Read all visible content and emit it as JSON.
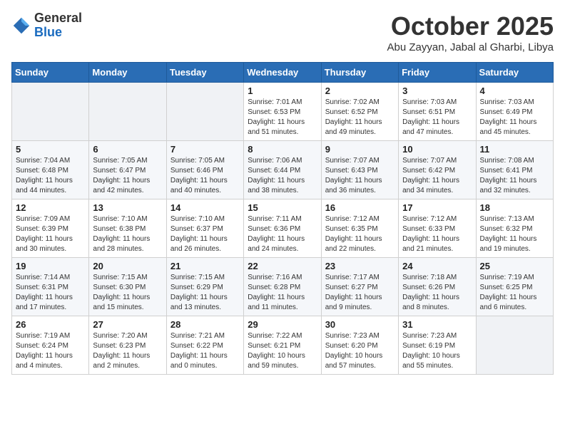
{
  "logo": {
    "general": "General",
    "blue": "Blue"
  },
  "header": {
    "month": "October 2025",
    "location": "Abu Zayyan, Jabal al Gharbi, Libya"
  },
  "weekdays": [
    "Sunday",
    "Monday",
    "Tuesday",
    "Wednesday",
    "Thursday",
    "Friday",
    "Saturday"
  ],
  "weeks": [
    [
      {
        "day": "",
        "sunrise": "",
        "sunset": "",
        "daylight": ""
      },
      {
        "day": "",
        "sunrise": "",
        "sunset": "",
        "daylight": ""
      },
      {
        "day": "",
        "sunrise": "",
        "sunset": "",
        "daylight": ""
      },
      {
        "day": "1",
        "sunrise": "Sunrise: 7:01 AM",
        "sunset": "Sunset: 6:53 PM",
        "daylight": "Daylight: 11 hours and 51 minutes."
      },
      {
        "day": "2",
        "sunrise": "Sunrise: 7:02 AM",
        "sunset": "Sunset: 6:52 PM",
        "daylight": "Daylight: 11 hours and 49 minutes."
      },
      {
        "day": "3",
        "sunrise": "Sunrise: 7:03 AM",
        "sunset": "Sunset: 6:51 PM",
        "daylight": "Daylight: 11 hours and 47 minutes."
      },
      {
        "day": "4",
        "sunrise": "Sunrise: 7:03 AM",
        "sunset": "Sunset: 6:49 PM",
        "daylight": "Daylight: 11 hours and 45 minutes."
      }
    ],
    [
      {
        "day": "5",
        "sunrise": "Sunrise: 7:04 AM",
        "sunset": "Sunset: 6:48 PM",
        "daylight": "Daylight: 11 hours and 44 minutes."
      },
      {
        "day": "6",
        "sunrise": "Sunrise: 7:05 AM",
        "sunset": "Sunset: 6:47 PM",
        "daylight": "Daylight: 11 hours and 42 minutes."
      },
      {
        "day": "7",
        "sunrise": "Sunrise: 7:05 AM",
        "sunset": "Sunset: 6:46 PM",
        "daylight": "Daylight: 11 hours and 40 minutes."
      },
      {
        "day": "8",
        "sunrise": "Sunrise: 7:06 AM",
        "sunset": "Sunset: 6:44 PM",
        "daylight": "Daylight: 11 hours and 38 minutes."
      },
      {
        "day": "9",
        "sunrise": "Sunrise: 7:07 AM",
        "sunset": "Sunset: 6:43 PM",
        "daylight": "Daylight: 11 hours and 36 minutes."
      },
      {
        "day": "10",
        "sunrise": "Sunrise: 7:07 AM",
        "sunset": "Sunset: 6:42 PM",
        "daylight": "Daylight: 11 hours and 34 minutes."
      },
      {
        "day": "11",
        "sunrise": "Sunrise: 7:08 AM",
        "sunset": "Sunset: 6:41 PM",
        "daylight": "Daylight: 11 hours and 32 minutes."
      }
    ],
    [
      {
        "day": "12",
        "sunrise": "Sunrise: 7:09 AM",
        "sunset": "Sunset: 6:39 PM",
        "daylight": "Daylight: 11 hours and 30 minutes."
      },
      {
        "day": "13",
        "sunrise": "Sunrise: 7:10 AM",
        "sunset": "Sunset: 6:38 PM",
        "daylight": "Daylight: 11 hours and 28 minutes."
      },
      {
        "day": "14",
        "sunrise": "Sunrise: 7:10 AM",
        "sunset": "Sunset: 6:37 PM",
        "daylight": "Daylight: 11 hours and 26 minutes."
      },
      {
        "day": "15",
        "sunrise": "Sunrise: 7:11 AM",
        "sunset": "Sunset: 6:36 PM",
        "daylight": "Daylight: 11 hours and 24 minutes."
      },
      {
        "day": "16",
        "sunrise": "Sunrise: 7:12 AM",
        "sunset": "Sunset: 6:35 PM",
        "daylight": "Daylight: 11 hours and 22 minutes."
      },
      {
        "day": "17",
        "sunrise": "Sunrise: 7:12 AM",
        "sunset": "Sunset: 6:33 PM",
        "daylight": "Daylight: 11 hours and 21 minutes."
      },
      {
        "day": "18",
        "sunrise": "Sunrise: 7:13 AM",
        "sunset": "Sunset: 6:32 PM",
        "daylight": "Daylight: 11 hours and 19 minutes."
      }
    ],
    [
      {
        "day": "19",
        "sunrise": "Sunrise: 7:14 AM",
        "sunset": "Sunset: 6:31 PM",
        "daylight": "Daylight: 11 hours and 17 minutes."
      },
      {
        "day": "20",
        "sunrise": "Sunrise: 7:15 AM",
        "sunset": "Sunset: 6:30 PM",
        "daylight": "Daylight: 11 hours and 15 minutes."
      },
      {
        "day": "21",
        "sunrise": "Sunrise: 7:15 AM",
        "sunset": "Sunset: 6:29 PM",
        "daylight": "Daylight: 11 hours and 13 minutes."
      },
      {
        "day": "22",
        "sunrise": "Sunrise: 7:16 AM",
        "sunset": "Sunset: 6:28 PM",
        "daylight": "Daylight: 11 hours and 11 minutes."
      },
      {
        "day": "23",
        "sunrise": "Sunrise: 7:17 AM",
        "sunset": "Sunset: 6:27 PM",
        "daylight": "Daylight: 11 hours and 9 minutes."
      },
      {
        "day": "24",
        "sunrise": "Sunrise: 7:18 AM",
        "sunset": "Sunset: 6:26 PM",
        "daylight": "Daylight: 11 hours and 8 minutes."
      },
      {
        "day": "25",
        "sunrise": "Sunrise: 7:19 AM",
        "sunset": "Sunset: 6:25 PM",
        "daylight": "Daylight: 11 hours and 6 minutes."
      }
    ],
    [
      {
        "day": "26",
        "sunrise": "Sunrise: 7:19 AM",
        "sunset": "Sunset: 6:24 PM",
        "daylight": "Daylight: 11 hours and 4 minutes."
      },
      {
        "day": "27",
        "sunrise": "Sunrise: 7:20 AM",
        "sunset": "Sunset: 6:23 PM",
        "daylight": "Daylight: 11 hours and 2 minutes."
      },
      {
        "day": "28",
        "sunrise": "Sunrise: 7:21 AM",
        "sunset": "Sunset: 6:22 PM",
        "daylight": "Daylight: 11 hours and 0 minutes."
      },
      {
        "day": "29",
        "sunrise": "Sunrise: 7:22 AM",
        "sunset": "Sunset: 6:21 PM",
        "daylight": "Daylight: 10 hours and 59 minutes."
      },
      {
        "day": "30",
        "sunrise": "Sunrise: 7:23 AM",
        "sunset": "Sunset: 6:20 PM",
        "daylight": "Daylight: 10 hours and 57 minutes."
      },
      {
        "day": "31",
        "sunrise": "Sunrise: 7:23 AM",
        "sunset": "Sunset: 6:19 PM",
        "daylight": "Daylight: 10 hours and 55 minutes."
      },
      {
        "day": "",
        "sunrise": "",
        "sunset": "",
        "daylight": ""
      }
    ]
  ]
}
